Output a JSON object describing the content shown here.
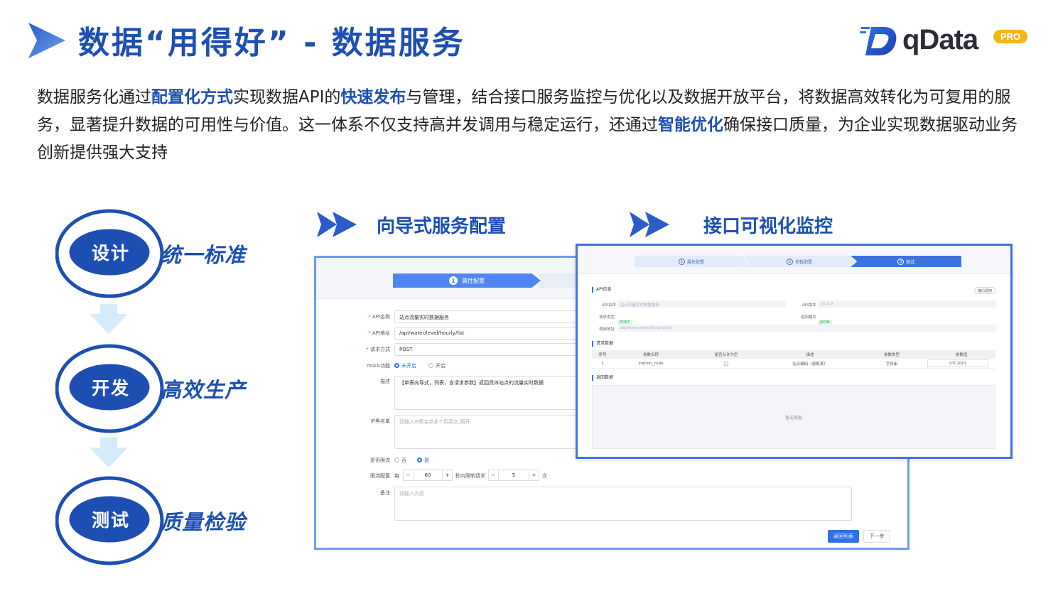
{
  "header": {
    "title": "数据“用得好” - 数据服务",
    "logo_text": "qData",
    "logo_badge": "PRO"
  },
  "intro": {
    "p1": "数据服务化通过",
    "h1": "配置化方式",
    "p2": "实现数据API的",
    "h2": "快速发布",
    "p3": "与管理，结合接口服务监控与优化以及数据开放平台，将数据高效转化为可复用的服务，显著提升数据的可用性与价值。这一体系不仅支持高并发调用与稳定运行，还通过",
    "h3": "智能优化",
    "p4": "确保接口质量，为企业实现数据驱动业务创新提供强大支持"
  },
  "flow": [
    {
      "badge": "设计",
      "desc": "统一标准"
    },
    {
      "badge": "开发",
      "desc": "高效生产"
    },
    {
      "badge": "测试",
      "desc": "质量检验"
    }
  ],
  "sections": {
    "left_title": "向导式服务配置",
    "right_title": "接口可视化监控"
  },
  "wizard": {
    "step1_num": "1",
    "step1_label": "属性配置",
    "fields": {
      "api_name_label": "API名称",
      "api_name_value": "站点流量实时数据服务",
      "api_path_label": "API地址",
      "api_path_value": "/api/water/level/hourly/list",
      "method_label": "请求方式",
      "method_value": "POST",
      "mock_label": "mock功能",
      "mock_off": "未开启",
      "mock_on": "开启",
      "desc_label": "描述",
      "desc_value": "【单表向导式，列表，含请求参数】返回具体站点的流量实时数据",
      "ip_label": "IP黑名单",
      "ip_placeholder": "请输入IP黑名单多个用英文,隔开",
      "limit_label": "是否限流",
      "limit_no": "否",
      "limit_yes": "是",
      "limit_cfg_label": "限流配置",
      "limit_every": "每",
      "limit_seconds": "60",
      "limit_mid": "秒内限制请求",
      "limit_count": "5",
      "limit_unit": "次",
      "remark_label": "备注",
      "remark_placeholder": "请输入内容",
      "minus": "−",
      "plus": "+"
    },
    "btn_back": "返回列表",
    "btn_next": "下一步"
  },
  "monitor": {
    "steps": [
      {
        "num": "1",
        "label": "属性配置"
      },
      {
        "num": "2",
        "label": "参数配置"
      },
      {
        "num": "3",
        "label": "测试"
      }
    ],
    "section_api": "API信息",
    "btn_test": "接口调用",
    "api_name_label": "API名称",
    "api_name_value": "站点流量实时数据服务",
    "api_version_label": "API版本",
    "api_version_value": "v1.0.0",
    "method_label": "请求类型",
    "method_value": "POST",
    "format_label": "返回格式",
    "format_value": "JSON",
    "url_label": "调用地址",
    "url_value": "/api/water/level/hourly/list",
    "section_req": "请求数据",
    "table_headers": [
      "序号",
      "参数名称",
      "是否允许为空",
      "描述",
      "参数类型",
      "参数值"
    ],
    "table_rows": [
      [
        "1",
        "station_code",
        "",
        "站点编码（获取某）",
        "字符串",
        "STC1001"
      ]
    ],
    "section_resp": "返回数据",
    "empty_text": "暂无数据"
  },
  "colors": {
    "brand": "#1d4fb3",
    "accent": "#2f6fe8",
    "logo_badge": "#f6b61a"
  }
}
